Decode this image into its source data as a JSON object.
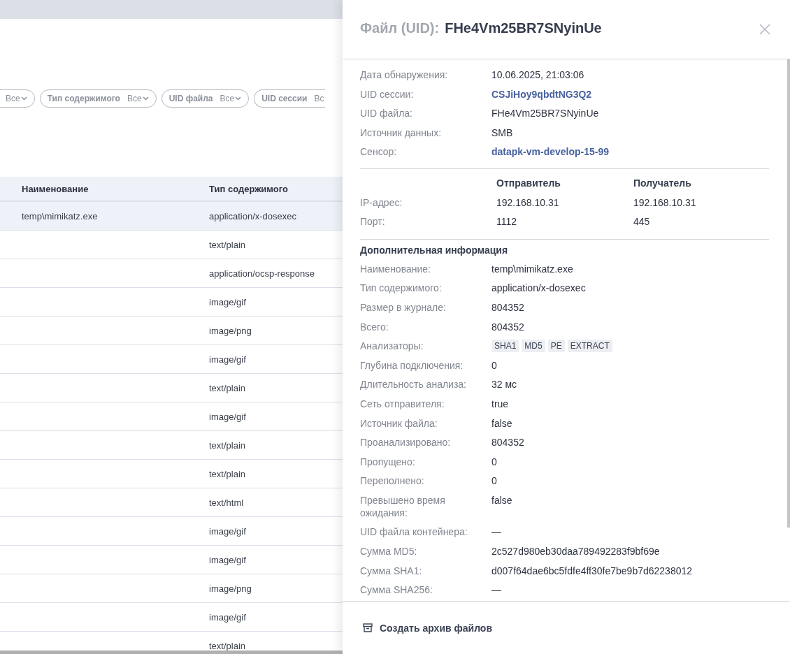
{
  "background_page": {
    "filters": [
      {
        "value": "Все",
        "cut": false
      },
      {
        "label": "Тип содержимого",
        "value": "Все",
        "cut": false
      },
      {
        "label": "UID файла",
        "value": "Все",
        "cut": false
      },
      {
        "label": "UID сессии",
        "value": "Вс",
        "cut": true
      }
    ],
    "table": {
      "columns": [
        "Наименование",
        "Тип содержимого"
      ],
      "rows": [
        {
          "name": "temp\\mimikatz.exe",
          "type": "application/x-dosexec",
          "selected": true
        },
        {
          "type": "text/plain",
          "selected": false
        },
        {
          "type": "application/ocsp-response",
          "selected": false
        },
        {
          "type": "image/gif",
          "selected": false
        },
        {
          "type": "image/png",
          "selected": false
        },
        {
          "type": "image/gif",
          "selected": false
        },
        {
          "type": "text/plain",
          "selected": false
        },
        {
          "type": "image/gif",
          "selected": false
        },
        {
          "type": "text/plain",
          "selected": false
        },
        {
          "type": "text/plain",
          "selected": false
        },
        {
          "type": "text/html",
          "selected": false
        },
        {
          "type": "image/gif",
          "selected": false
        },
        {
          "type": "image/gif",
          "selected": false
        },
        {
          "type": "image/png",
          "selected": false
        },
        {
          "type": "image/gif",
          "selected": false
        },
        {
          "type": "text/plain",
          "selected": false
        }
      ]
    }
  },
  "detail_panel": {
    "title_prefix": "Файл (UID):",
    "title": "FHe4Vm25BR7SNyinUe",
    "summary": [
      {
        "label": "Дата обнаружения:",
        "value": "10.06.2025, 21:03:06",
        "kind": "text"
      },
      {
        "label": "UID сессии:",
        "value": "CSJiHoy9qbdtNG3Q2",
        "kind": "link"
      },
      {
        "label": "UID файла:",
        "value": "FHe4Vm25BR7SNyinUe",
        "kind": "text"
      },
      {
        "label": "Источник данных:",
        "value": "SMB",
        "kind": "text"
      },
      {
        "label": "Сенсор:",
        "value": "datapk-vm-develop-15-99",
        "kind": "link"
      }
    ],
    "endpoints": {
      "columns": [
        "Отправитель",
        "Получатель"
      ],
      "rows": [
        {
          "label": "IP-адрес:",
          "sender": "192.168.10.31",
          "recipient": "192.168.10.31"
        },
        {
          "label": "Порт:",
          "sender": "1112",
          "recipient": "445"
        }
      ]
    },
    "additional": {
      "title": "Дополнительная информация",
      "rows": [
        {
          "label": "Наименование:",
          "value": "temp\\mimikatz.exe",
          "kind": "text"
        },
        {
          "label": "Тип содержимого:",
          "value": "application/x-dosexec",
          "kind": "text"
        },
        {
          "label": "Размер в журнале:",
          "value": "804352",
          "kind": "text"
        },
        {
          "label": "Всего:",
          "value": "804352",
          "kind": "text"
        },
        {
          "label": "Анализаторы:",
          "tags": [
            "SHA1",
            "MD5",
            "PE",
            "EXTRACT"
          ],
          "kind": "tags"
        },
        {
          "label": "Глубина подключения:",
          "value": "0",
          "kind": "text"
        },
        {
          "label": "Длительность анализа:",
          "value": "32 мс",
          "kind": "text"
        },
        {
          "label": "Сеть отправителя:",
          "value": "true",
          "kind": "text"
        },
        {
          "label": "Источник файла:",
          "value": "false",
          "kind": "text"
        },
        {
          "label": "Проанализировано:",
          "value": "804352",
          "kind": "text"
        },
        {
          "label": "Пропущено:",
          "value": "0",
          "kind": "text"
        },
        {
          "label": "Переполнено:",
          "value": "0",
          "kind": "text"
        },
        {
          "label": "Превышено время ожидания:",
          "value": "false",
          "kind": "text"
        },
        {
          "label": "UID файла контейнера:",
          "value": "—",
          "kind": "text"
        },
        {
          "label": "Сумма MD5:",
          "value": "2c527d980eb30daa789492283f9bf69e",
          "kind": "text"
        },
        {
          "label": "Сумма SHA1:",
          "value": "d007f64dae6bc5fdfe4ff30fe7be9b7d62238012",
          "kind": "text"
        },
        {
          "label": "Сумма SHA256:",
          "value": "—",
          "kind": "text"
        }
      ]
    },
    "archive_button": "Создать архив файлов"
  }
}
